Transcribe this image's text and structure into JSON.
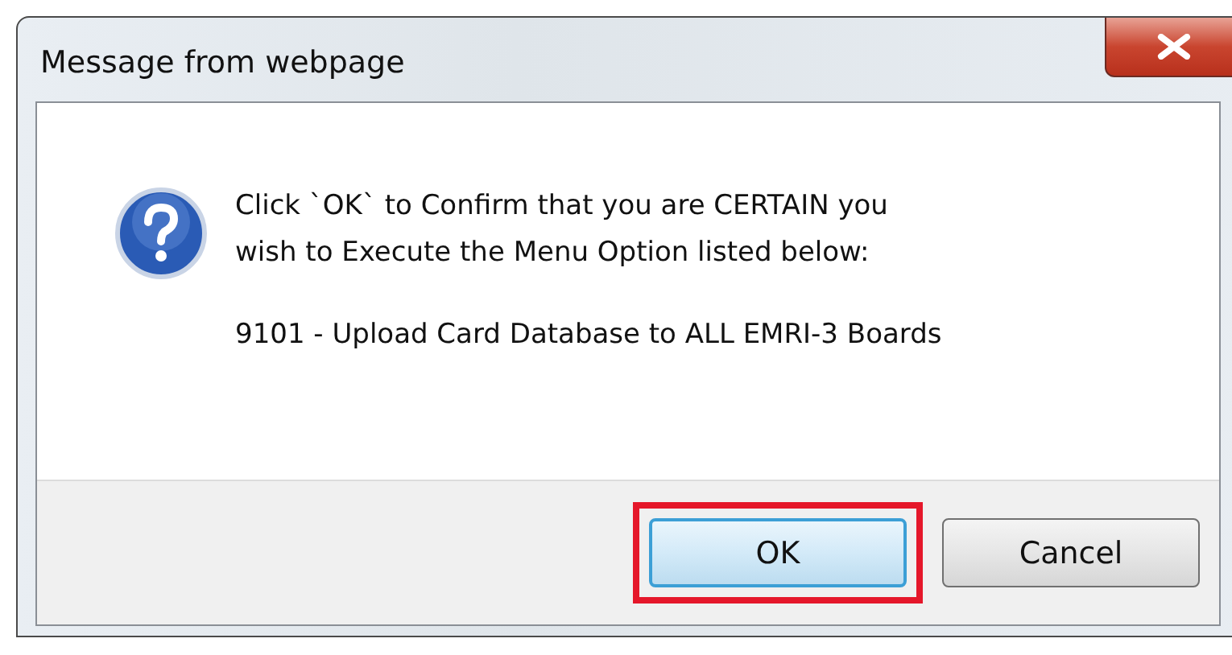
{
  "window": {
    "title": "Message from webpage"
  },
  "message": {
    "lines": [
      "Click `OK` to Confirm that you are CERTAIN you",
      "wish to Execute the Menu Option listed below:"
    ],
    "detail": "9101 - Upload Card Database to ALL EMRI-3 Boards"
  },
  "buttons": [
    {
      "label": "OK",
      "default": true,
      "highlighted": true
    },
    {
      "label": "Cancel",
      "default": false,
      "highlighted": false
    }
  ]
}
